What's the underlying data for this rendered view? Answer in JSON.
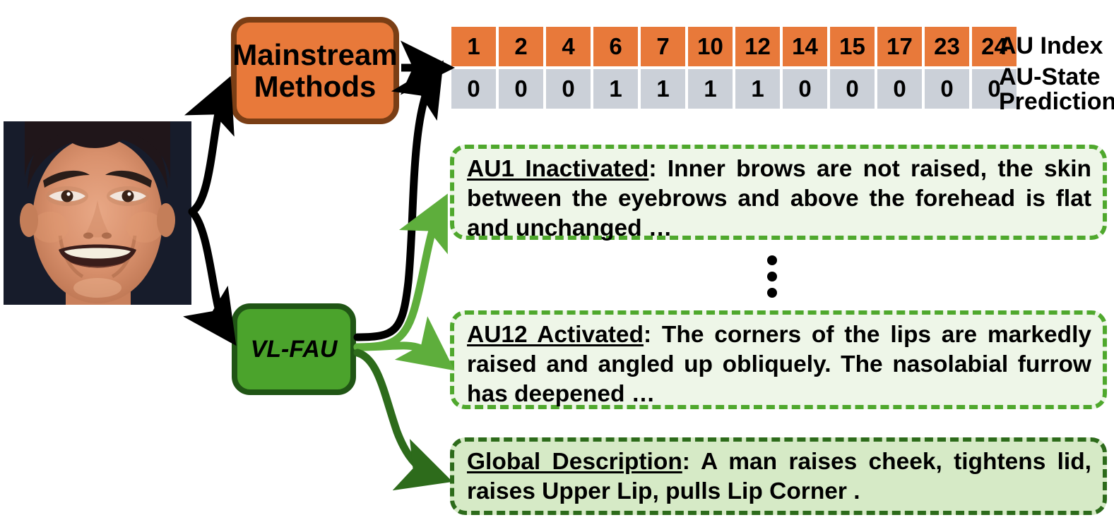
{
  "figure": {
    "title": "VL-FAU facial action unit recognition comparison figure",
    "colors": {
      "orange_fill": "#E8793A",
      "orange_border": "#7A3E15",
      "green_fill": "#4BA32C",
      "green_border": "#205515",
      "state_cell": "#CBD0D8",
      "desc_fill": "#EEF6E8",
      "desc_border": "#4FA82D",
      "global_fill": "#D6EAC6",
      "global_border": "#2D6B1B",
      "arrow_black": "#000000",
      "arrow_light_green": "#5EAE3C",
      "arrow_dark_green": "#2D6B1B"
    }
  },
  "input": {
    "image_name": "face-photo",
    "alt": "Smiling man's face on dark navy background"
  },
  "methods": {
    "mainstream": {
      "label": "Mainstream\nMethods",
      "line1": "Mainstream",
      "line2": "Methods"
    },
    "vlfau": {
      "label": "VL-FAU"
    }
  },
  "au_table": {
    "index_label": "AU Index",
    "state_label_line1": "AU-State",
    "state_label_line2": "Prediction",
    "au_index": [
      "1",
      "2",
      "4",
      "6",
      "7",
      "10",
      "12",
      "14",
      "15",
      "17",
      "23",
      "24"
    ],
    "au_state": [
      "0",
      "0",
      "0",
      "1",
      "1",
      "1",
      "1",
      "0",
      "0",
      "0",
      "0",
      "0"
    ]
  },
  "descriptions": [
    {
      "name": "au1-description",
      "lead": "AU1 Inactivated",
      "separator": ": ",
      "body": "Inner brows are not raised, the skin between the eyebrows and above the forehead is flat and unchanged …"
    },
    {
      "name": "au12-description",
      "lead": "AU12  Activated",
      "separator": ": ",
      "body": "The corners of the lips are markedly raised and angled up obliquely. The nasolabial furrow has deepened …"
    },
    {
      "name": "global-description",
      "lead": "Global Description",
      "separator": ": ",
      "body": "A man raises cheek, tightens lid, raises Upper Lip, pulls Lip Corner ."
    }
  ],
  "ellipsis": {
    "symbol": "⋮",
    "dots": 3
  }
}
